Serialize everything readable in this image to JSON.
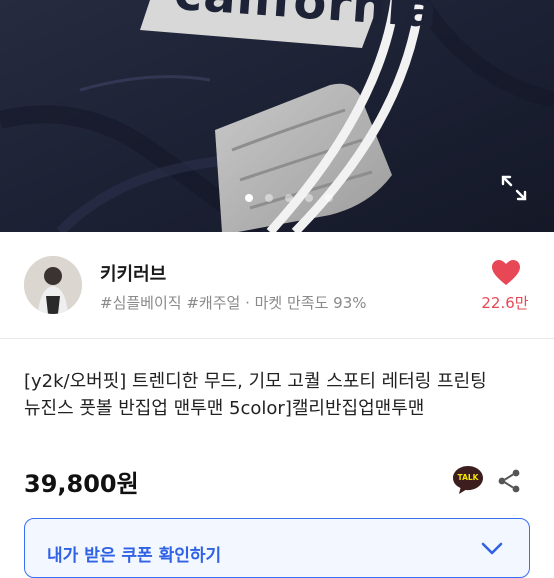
{
  "hero": {
    "print_text": "california",
    "slide_count": 5,
    "active_slide": 1,
    "expand_icon": "expand-icon"
  },
  "seller": {
    "name": "키키러브",
    "tags": "#심플베이직 #캐주얼 · 마켓 만족도 93%",
    "like_count": "22.6만",
    "like_icon": "heart-icon",
    "heart_color": "#e84856"
  },
  "product": {
    "title": "[y2k/오버핏] 트렌디한 무드, 기모 고퀄 스포티 레터링 프린팅 뉴진스 풋볼 반집업 맨투맨 5color]캘리반집업맨투맨",
    "price": "39,800원",
    "talk_label": "TALK",
    "share_icon": "share-icon"
  },
  "coupon": {
    "label": "내가 받은 쿠폰 확인하기",
    "chevron_icon": "chevron-down-icon",
    "accent": "#2f62e5"
  }
}
